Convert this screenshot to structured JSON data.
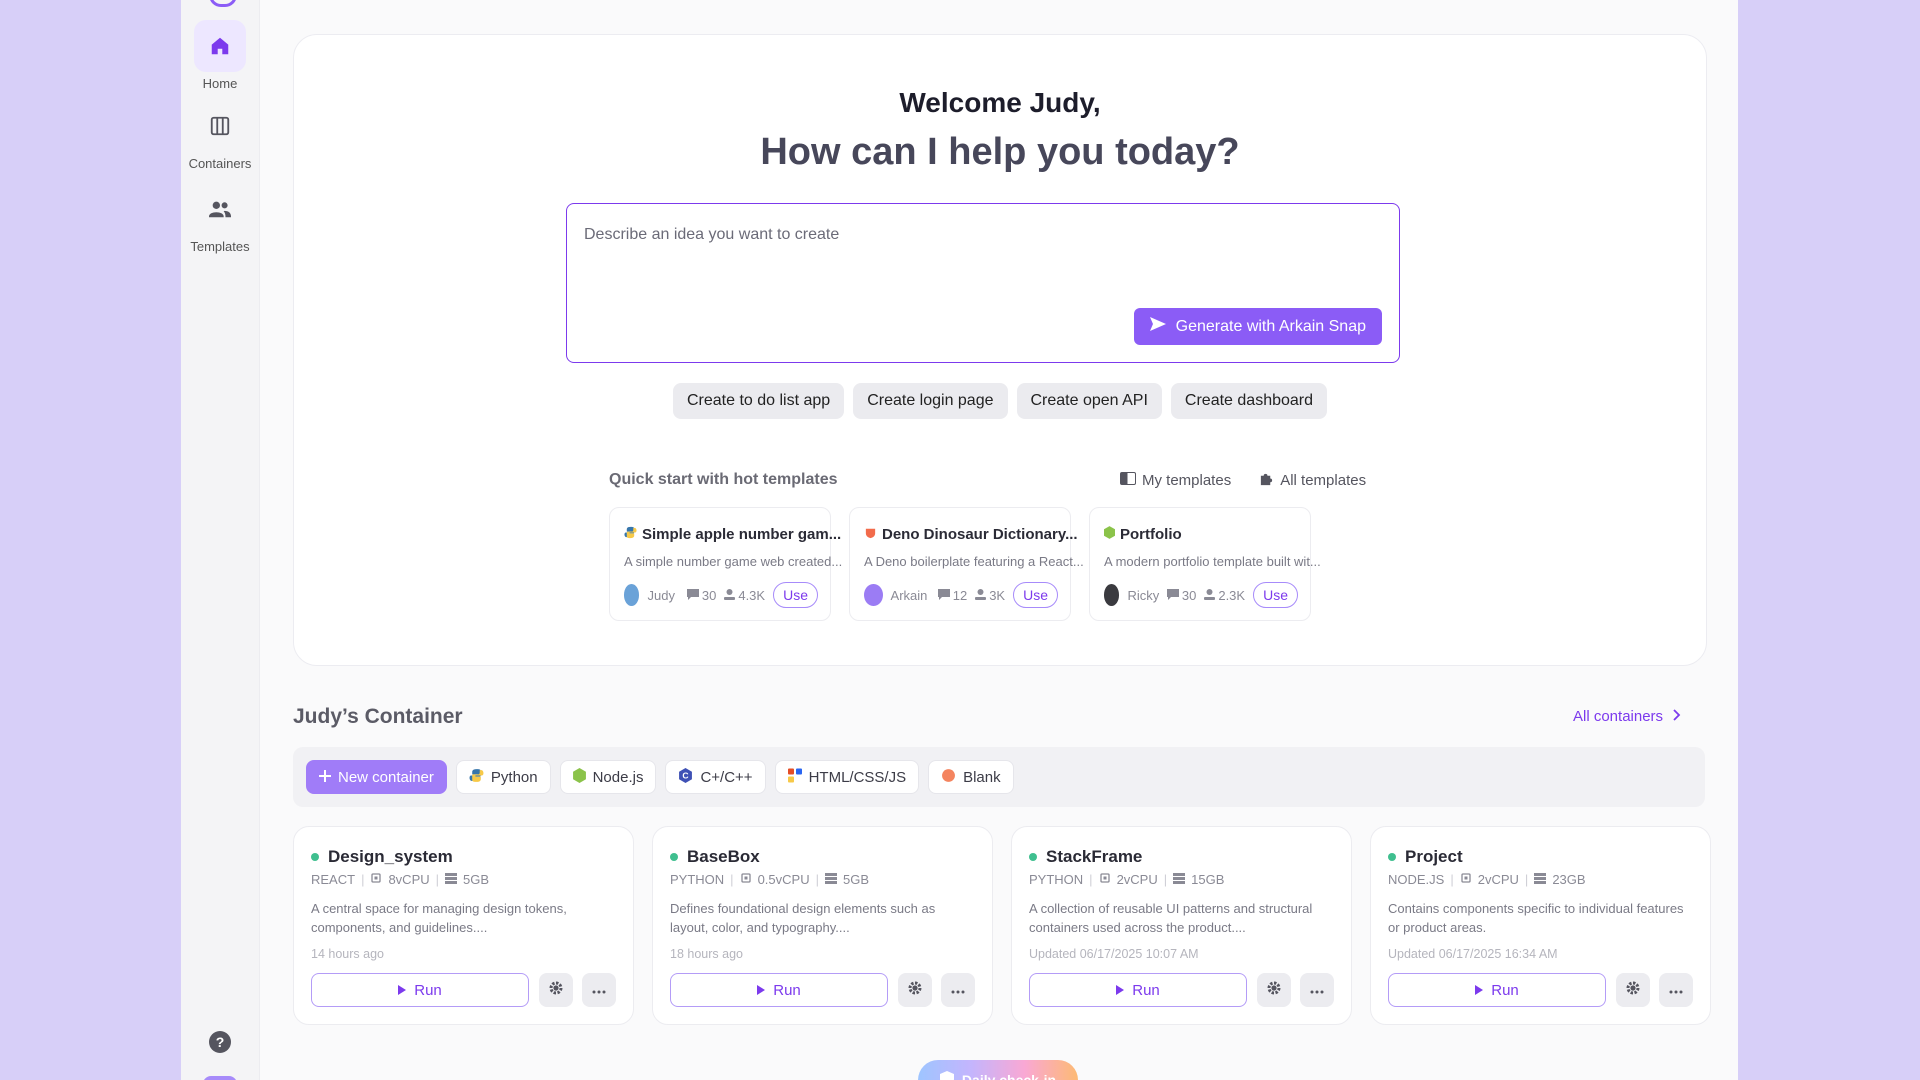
{
  "sidebar": {
    "items": [
      {
        "label": "Home",
        "icon": "home-icon",
        "active": true
      },
      {
        "label": "Containers",
        "icon": "containers-icon",
        "active": false
      },
      {
        "label": "Templates",
        "icon": "users-icon",
        "active": false
      }
    ],
    "help_icon": "help-icon"
  },
  "hero": {
    "welcome": "Welcome Judy,",
    "tagline": "How can I help you today?",
    "prompt_placeholder": "Describe an idea you want to create",
    "generate_label": "Generate with Arkain Snap",
    "suggestions": [
      "Create to do list app",
      "Create login page",
      "Create open API",
      "Create dashboard"
    ]
  },
  "quick_start": {
    "title": "Quick start with hot templates",
    "my_templates": "My templates",
    "all_templates": "All templates",
    "templates": [
      {
        "name": "Simple apple number gam...",
        "desc": "A simple number game web created...",
        "author": "Judy",
        "comments": "30",
        "downloads": "4.3K",
        "use": "Use",
        "avatar_color": "#6aa2d8",
        "icon_color": "#3776ab"
      },
      {
        "name": "Deno Dinosaur Dictionary...",
        "desc": "A Deno boilerplate featuring a React...",
        "author": "Arkain",
        "comments": "12",
        "downloads": "3K",
        "use": "Use",
        "avatar_color": "#9b7cf4",
        "icon_color": "#f26b4b"
      },
      {
        "name": "Portfolio",
        "desc": "A modern portfolio template built wit...",
        "author": "Ricky",
        "comments": "30",
        "downloads": "2.3K",
        "use": "Use",
        "avatar_color": "#3a3a3f",
        "icon_color": "#8bc34a"
      }
    ]
  },
  "containers": {
    "title": "Judy’s Container",
    "all_label": "All containers",
    "new_label": "New container",
    "filters": [
      {
        "label": "Python",
        "icon": "python-icon",
        "color": "#3776ab"
      },
      {
        "label": "Node.js",
        "icon": "nodejs-icon",
        "color": "#8bc34a"
      },
      {
        "label": "C+/C++",
        "icon": "cpp-icon",
        "color": "#3f51b5"
      },
      {
        "label": "HTML/CSS/JS",
        "icon": "html-icon",
        "color": "#e44d26"
      },
      {
        "label": "Blank",
        "icon": "blank-icon",
        "color": "#f4845f"
      }
    ],
    "items": [
      {
        "name": "Design_system",
        "stack": "REACT",
        "cpu": "8vCPU",
        "storage": "5GB",
        "desc": "A central space for managing design tokens, components, and guidelines....",
        "time": "14 hours ago",
        "run": "Run"
      },
      {
        "name": "BaseBox",
        "stack": "PYTHON",
        "cpu": "0.5vCPU",
        "storage": "5GB",
        "desc": "Defines foundational design elements such as layout, color, and typography....",
        "time": "18 hours ago",
        "run": "Run"
      },
      {
        "name": "StackFrame",
        "stack": "PYTHON",
        "cpu": "2vCPU",
        "storage": "15GB",
        "desc": "A collection of reusable UI patterns and structural containers used across the product....",
        "time": "Updated 06/17/2025 10:07 AM",
        "run": "Run"
      },
      {
        "name": "Project",
        "stack": "NODE.JS",
        "cpu": "2vCPU",
        "storage": "23GB",
        "desc": "Contains components specific to individual features or product areas.",
        "time": "Updated 06/17/2025 16:34 AM",
        "run": "Run"
      }
    ]
  },
  "daily_check": "Daily check-in",
  "colors": {
    "accent": "#8b5cf6",
    "status_green": "#3fbf8f",
    "background": "#d7cff8"
  }
}
